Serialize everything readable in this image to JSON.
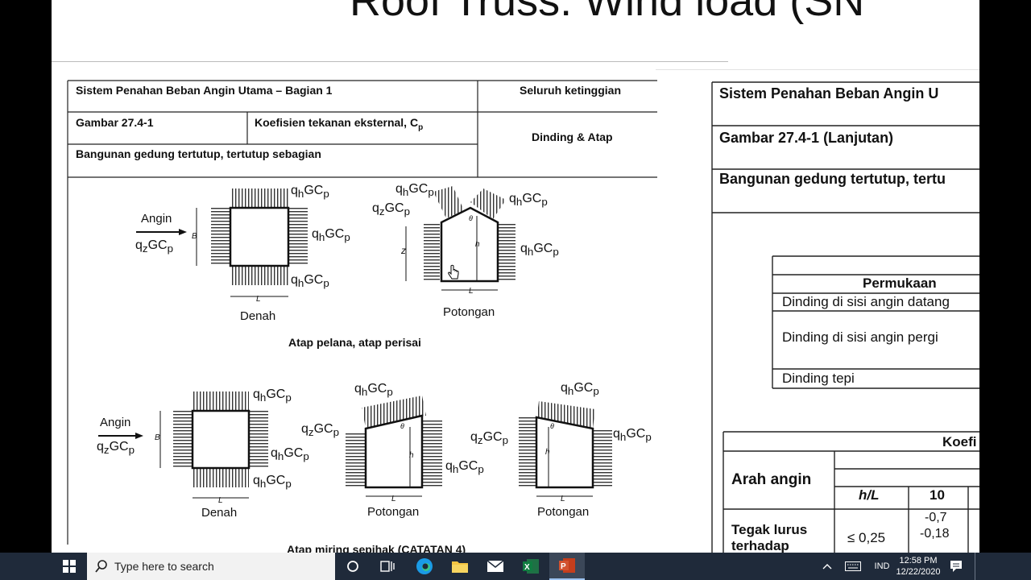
{
  "slide": {
    "title": "Roof Truss:  Wind load (SN"
  },
  "left_doc": {
    "header_1": "Sistem Penahan Beban Angin Utama – Bagian 1",
    "header_2": "Seluruh ketinggian",
    "figure": "Gambar 27.4-1",
    "coef_label": "Koefisien tekanan eksternal, C",
    "coef_sub": "p",
    "dinding_atap": "Dinding & Atap",
    "building": "Bangunan gedung tertutup, tertutup sebagian",
    "angin": "Angin",
    "denah": "Denah",
    "potongan": "Potongan",
    "caption_1": "Atap pelana, atap perisai",
    "caption_2": "Atap miring sepihak (CATATAN 4)",
    "label_B": "B",
    "label_L": "L",
    "label_z": "z",
    "label_h": "h",
    "label_theta": "θ"
  },
  "right_doc": {
    "header": "Sistem Penahan Beban Angin U",
    "figure": "Gambar 27.4-1 (Lanjutan)",
    "building": "Bangunan gedung tertutup, tertu",
    "table1": {
      "header": "Permukaan",
      "rows": [
        "Dinding di sisi angin datang",
        "Dinding di sisi angin pergi",
        "Dinding tepi"
      ]
    },
    "table2": {
      "header": "Koefi",
      "arah": "Arah angin",
      "hL": "h/L",
      "col10": "10",
      "row1_label_a": "Tegak lurus",
      "row1_label_b": "terhadap",
      "row1_hl": "≤ 0,25",
      "row1_v1": "-0,7",
      "row1_v2": "-0,18"
    }
  },
  "taskbar": {
    "search_placeholder": "Type here to search",
    "lang": "IND",
    "time": "12:58 PM",
    "date": "12/22/2020"
  }
}
